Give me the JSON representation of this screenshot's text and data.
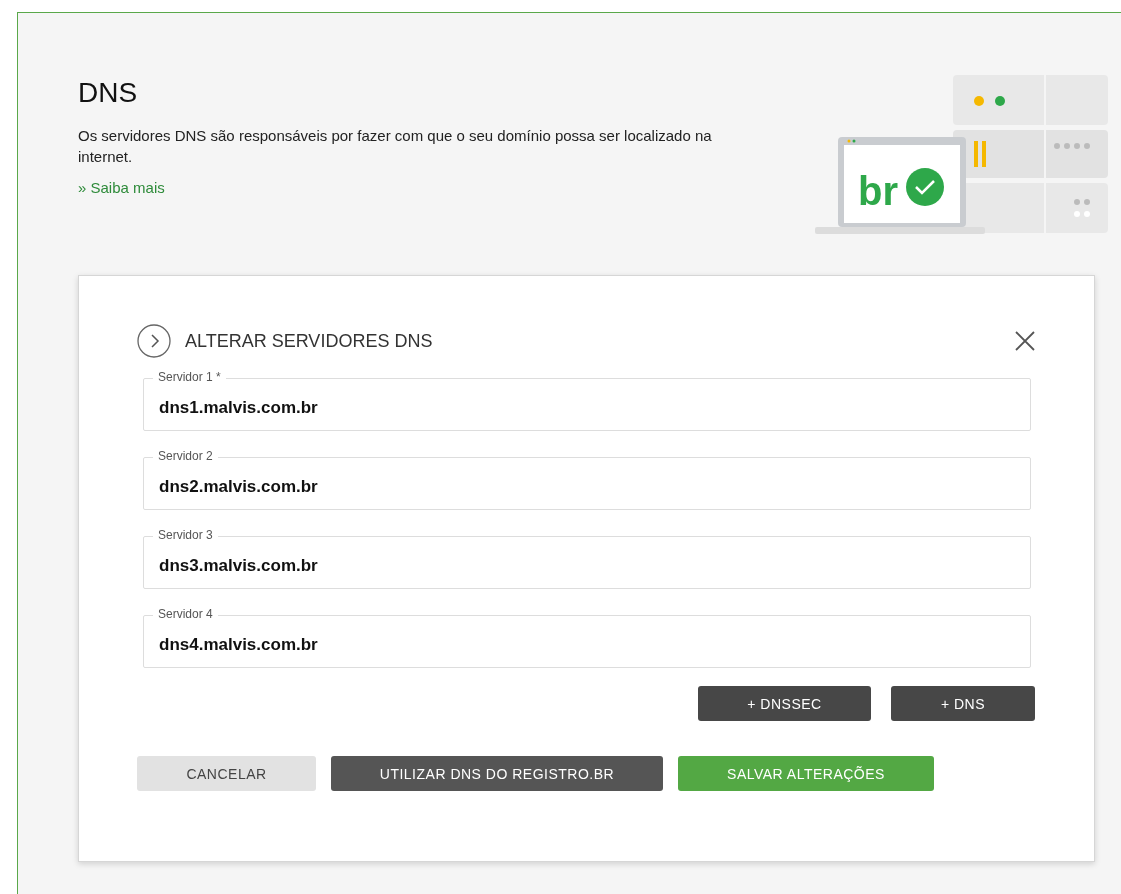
{
  "header": {
    "title": "DNS",
    "description": "Os servidores DNS são responsáveis por fazer com que o seu domínio possa ser localizado na internet.",
    "link": "» Saiba mais",
    "illustration_logo": "br"
  },
  "panel": {
    "title": "ALTERAR SERVIDORES DNS",
    "fields": [
      {
        "label": "Servidor 1 *",
        "value": "dns1.malvis.com.br"
      },
      {
        "label": "Servidor 2",
        "value": "dns2.malvis.com.br"
      },
      {
        "label": "Servidor 3",
        "value": "dns3.malvis.com.br"
      },
      {
        "label": "Servidor 4",
        "value": "dns4.malvis.com.br"
      }
    ],
    "add_buttons": [
      "+ DNSSEC",
      "+ DNS"
    ],
    "actions": [
      {
        "label": "CANCELAR",
        "kind": "secondary"
      },
      {
        "label": "UTILIZAR DNS DO REGISTRO.BR",
        "kind": "dark"
      },
      {
        "label": "SALVAR ALTERAÇÕES",
        "kind": "primary"
      }
    ]
  }
}
